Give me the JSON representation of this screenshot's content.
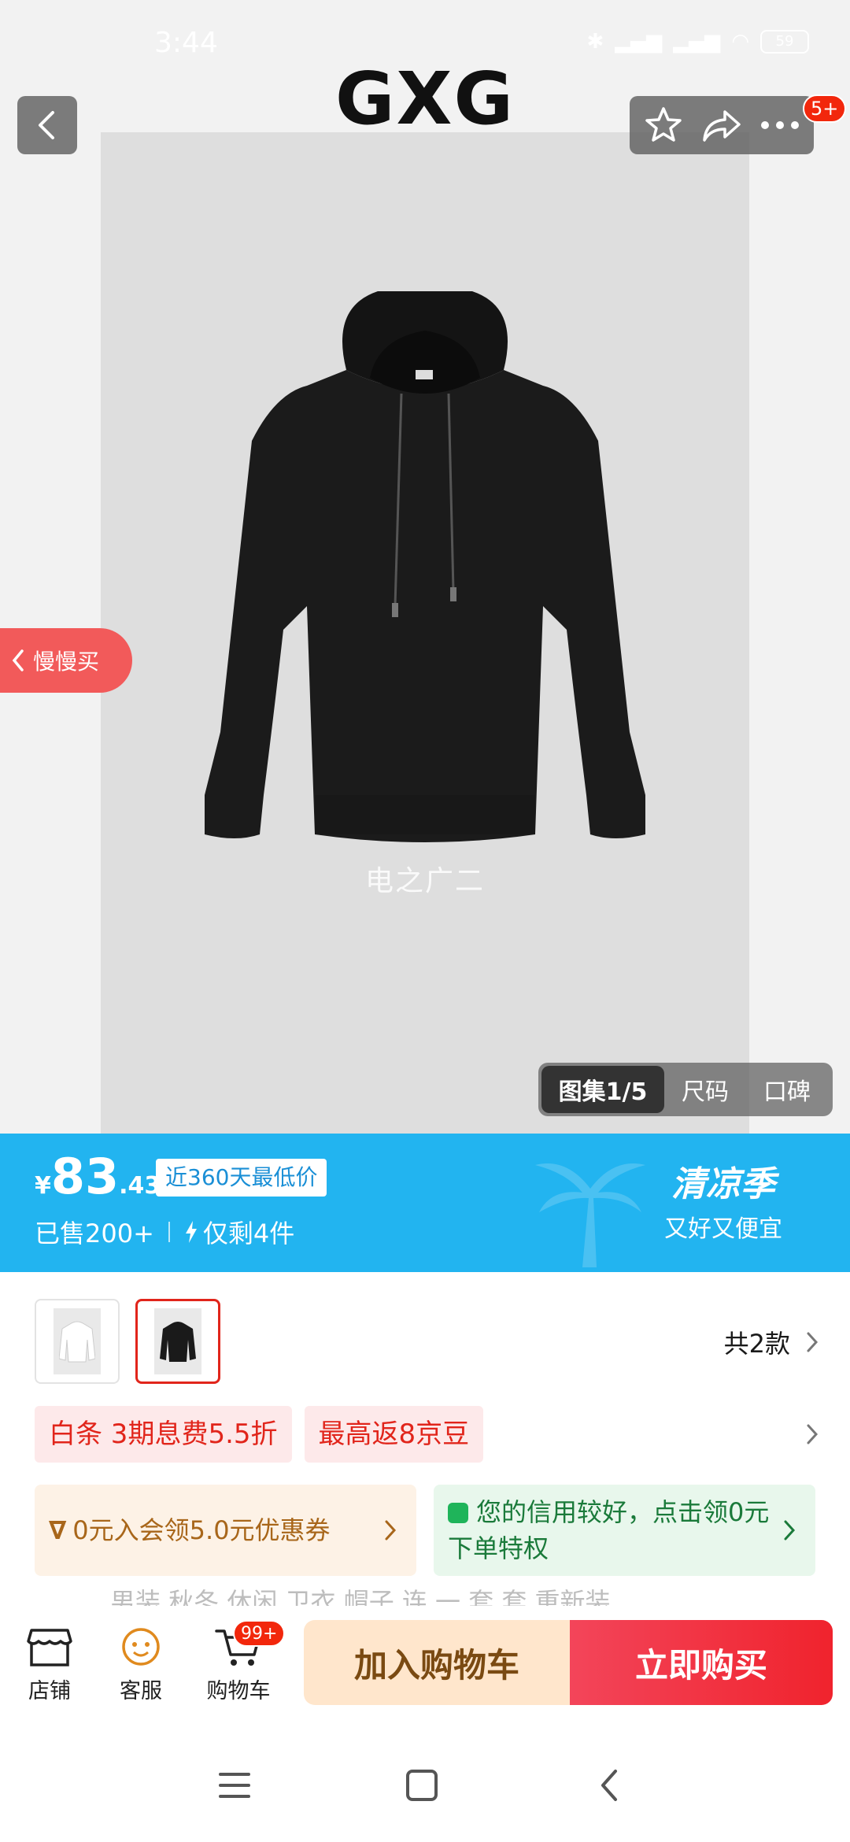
{
  "status_bar": {
    "time": "3:44",
    "battery": "59",
    "icons": [
      "bluetooth-icon",
      "signal-hd-icon",
      "signal-hd-icon",
      "wifi-icon"
    ]
  },
  "header": {
    "brand": "GXG",
    "message_badge": "5+",
    "icons": [
      "back-icon",
      "star-icon",
      "share-icon",
      "more-icon"
    ]
  },
  "product_image": {
    "watermark": "电之广二",
    "subject": "black hoodie"
  },
  "side_tab": {
    "label": "慢慢买"
  },
  "gallery_tabs": [
    {
      "label": "图集1/5",
      "active": true
    },
    {
      "label": "尺码",
      "active": false
    },
    {
      "label": "口碑",
      "active": false
    }
  ],
  "price": {
    "currency": "¥",
    "integer": "83",
    "decimal": ".43",
    "low_price_tag": "近360天最低价",
    "sold": "已售200+",
    "stock": "仅剩4件",
    "season_title": "清凉季",
    "season_sub": "又好又便宜"
  },
  "variants": {
    "count_label": "共2款",
    "thumbs": [
      {
        "name": "white hoodie",
        "selected": false
      },
      {
        "name": "black hoodie",
        "selected": true
      }
    ]
  },
  "promos": [
    "白条  3期息费5.5折",
    "最高返8京豆"
  ],
  "cards": [
    {
      "text": "0元入会领5.0元优惠券",
      "color": "#a8661a"
    },
    {
      "text": "您的信用较好，点击领0元下单特权",
      "color": "#1a7a3a"
    }
  ],
  "peek_text": "男装 秋冬 休闲 卫衣 帽子 连 一 套 套 重新装",
  "bottom_nav": [
    {
      "label": "店铺"
    },
    {
      "label": "客服"
    },
    {
      "label": "购物车",
      "badge": "99+"
    }
  ],
  "actions": {
    "add_to_cart": "加入购物车",
    "buy_now": "立即购买"
  },
  "colors": {
    "price_banner": "#22b4f0",
    "accent_red": "#e1251b",
    "cart_button": "#ffe6cc"
  }
}
